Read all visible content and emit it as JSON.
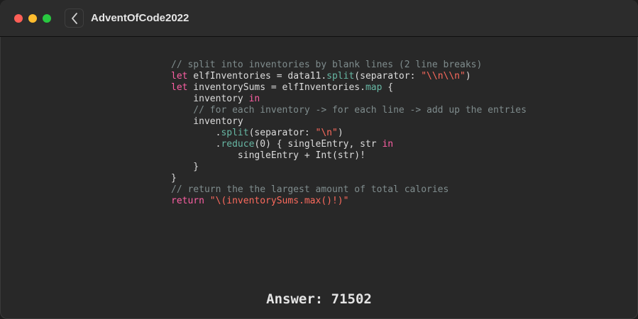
{
  "window": {
    "title": "AdventOfCode2022",
    "back_icon": "chevron-left-icon",
    "controls": [
      "close",
      "minimize",
      "zoom"
    ]
  },
  "code": {
    "language": "swift",
    "lines": [
      [
        {
          "t": "// split into inventories by blank lines (2 line breaks)",
          "c": "cm"
        }
      ],
      [
        {
          "t": "let",
          "c": "kw"
        },
        {
          "t": " elfInventories = data11.",
          "c": ""
        },
        {
          "t": "split",
          "c": "fn"
        },
        {
          "t": "(separator: ",
          "c": ""
        },
        {
          "t": "\"\\\\n\\\\n\"",
          "c": "st"
        },
        {
          "t": ")",
          "c": ""
        }
      ],
      [
        {
          "t": "let",
          "c": "kw"
        },
        {
          "t": " inventorySums = elfInventories.",
          "c": ""
        },
        {
          "t": "map",
          "c": "fn"
        },
        {
          "t": " {",
          "c": ""
        }
      ],
      [
        {
          "t": "    inventory ",
          "c": ""
        },
        {
          "t": "in",
          "c": "kw"
        }
      ],
      [
        {
          "t": "    // for each inventory -> for each line -> add up the entries",
          "c": "cm"
        }
      ],
      [
        {
          "t": "    inventory",
          "c": ""
        }
      ],
      [
        {
          "t": "        .",
          "c": ""
        },
        {
          "t": "split",
          "c": "fn"
        },
        {
          "t": "(separator: ",
          "c": ""
        },
        {
          "t": "\"\\n\"",
          "c": "st"
        },
        {
          "t": ")",
          "c": ""
        }
      ],
      [
        {
          "t": "        .",
          "c": ""
        },
        {
          "t": "reduce",
          "c": "fn"
        },
        {
          "t": "(0) { singleEntry, str ",
          "c": ""
        },
        {
          "t": "in",
          "c": "kw"
        }
      ],
      [
        {
          "t": "            singleEntry + Int(str)!",
          "c": ""
        }
      ],
      [
        {
          "t": "    }",
          "c": ""
        }
      ],
      [
        {
          "t": "}",
          "c": ""
        }
      ],
      [
        {
          "t": "// return the the largest amount of total calories",
          "c": "cm"
        }
      ],
      [
        {
          "t": "return",
          "c": "kw"
        },
        {
          "t": " \"\\(inventorySums.max()!)\"",
          "c": "st"
        }
      ]
    ]
  },
  "answer": {
    "label": "Answer:",
    "value": "71502"
  },
  "colors": {
    "comment": "#7f8c8d",
    "keyword": "#fc5fa3",
    "function": "#67b7a4",
    "string": "#fc6a5d",
    "text": "#dcdcdc"
  }
}
